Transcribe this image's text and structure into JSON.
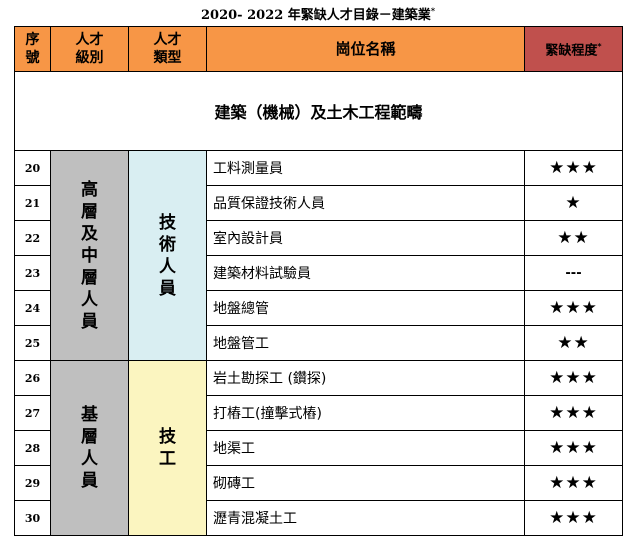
{
  "title": "2020- 2022 年緊缺人才目錄－建築業",
  "title_mark": "*",
  "header": {
    "serial": "序號",
    "level": "人才級別",
    "type": "人才類型",
    "position": "崗位名稱",
    "severity": "緊缺程度",
    "severity_mark": "*"
  },
  "section_title": "建築（機械）及土木工程範疇",
  "groups": {
    "senior_level": "高層及中層人員",
    "technical_type": "技術人員",
    "basic_level": "基層人員",
    "worker_type": "技工"
  },
  "rows": [
    {
      "no": "20",
      "position": "工料測量員",
      "shortage": "★★★"
    },
    {
      "no": "21",
      "position": "品質保證技術人員",
      "shortage": "★"
    },
    {
      "no": "22",
      "position": "室內設計員",
      "shortage": "★★"
    },
    {
      "no": "23",
      "position": "建築材料試驗員",
      "shortage": "---"
    },
    {
      "no": "24",
      "position": "地盤總管",
      "shortage": "★★★"
    },
    {
      "no": "25",
      "position": "地盤管工",
      "shortage": "★★"
    },
    {
      "no": "26",
      "position": "岩土勘探工 (鑽探)",
      "shortage": "★★★"
    },
    {
      "no": "27",
      "position": "打樁工(撞擊式樁)",
      "shortage": "★★★"
    },
    {
      "no": "28",
      "position": "地渠工",
      "shortage": "★★★"
    },
    {
      "no": "29",
      "position": "砌磚工",
      "shortage": "★★★"
    },
    {
      "no": "30",
      "position": "瀝青混凝土工",
      "shortage": "★★★"
    }
  ],
  "colors": {
    "header_bg": "#f79646",
    "severity_header_bg": "#c0504d",
    "level_bg": "#bfbfbf",
    "technical_bg": "#d9eef2",
    "worker_bg": "#fbf5c0"
  }
}
